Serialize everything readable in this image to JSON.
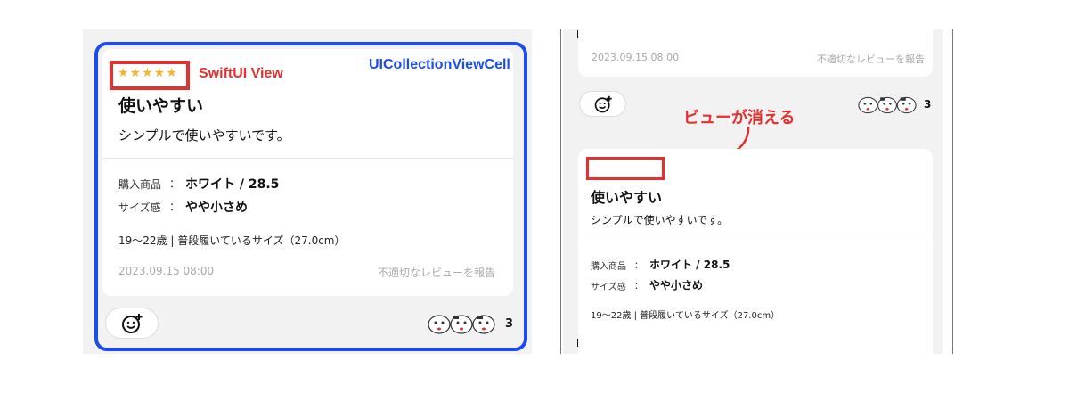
{
  "left": {
    "stars": "★★★★★",
    "swiftui_label": "SwiftUI View",
    "uicollection_label": "UICollectionViewCell",
    "title": "使いやすい",
    "body": "シンプルで使いやすいです。",
    "purchase_label": "購入商品",
    "purchase_sep": "：",
    "purchase_value": "ホワイト / 28.5",
    "size_label": "サイズ感",
    "size_sep": "：",
    "size_value": "やや小さめ",
    "meta": "19～22歳 | 普段履いているサイズ（27.0cm）",
    "date": "2023.09.15 08:00",
    "report": "不適切なレビューを報告",
    "reaction_count": "3"
  },
  "right": {
    "top_date": "2023.09.15 08:00",
    "top_report": "不適切なレビューを報告",
    "reaction_count": "3",
    "vanish_label": "ビューが消える",
    "title": "使いやすい",
    "body": "シンプルで使いやすいです。",
    "purchase_label": "購入商品",
    "purchase_sep": "：",
    "purchase_value": "ホワイト / 28.5",
    "size_label": "サイズ感",
    "size_sep": "：",
    "size_value": "やや小さめ",
    "meta": "19～22歳 | 普段履いているサイズ（27.0cm）"
  },
  "colors": {
    "accent_blue": "#1b4cf0",
    "annotation_red": "#e53030",
    "star": "#f2b531"
  },
  "icons": [
    "add-reaction-icon",
    "cat-sticker-icon",
    "arrow-icon"
  ]
}
